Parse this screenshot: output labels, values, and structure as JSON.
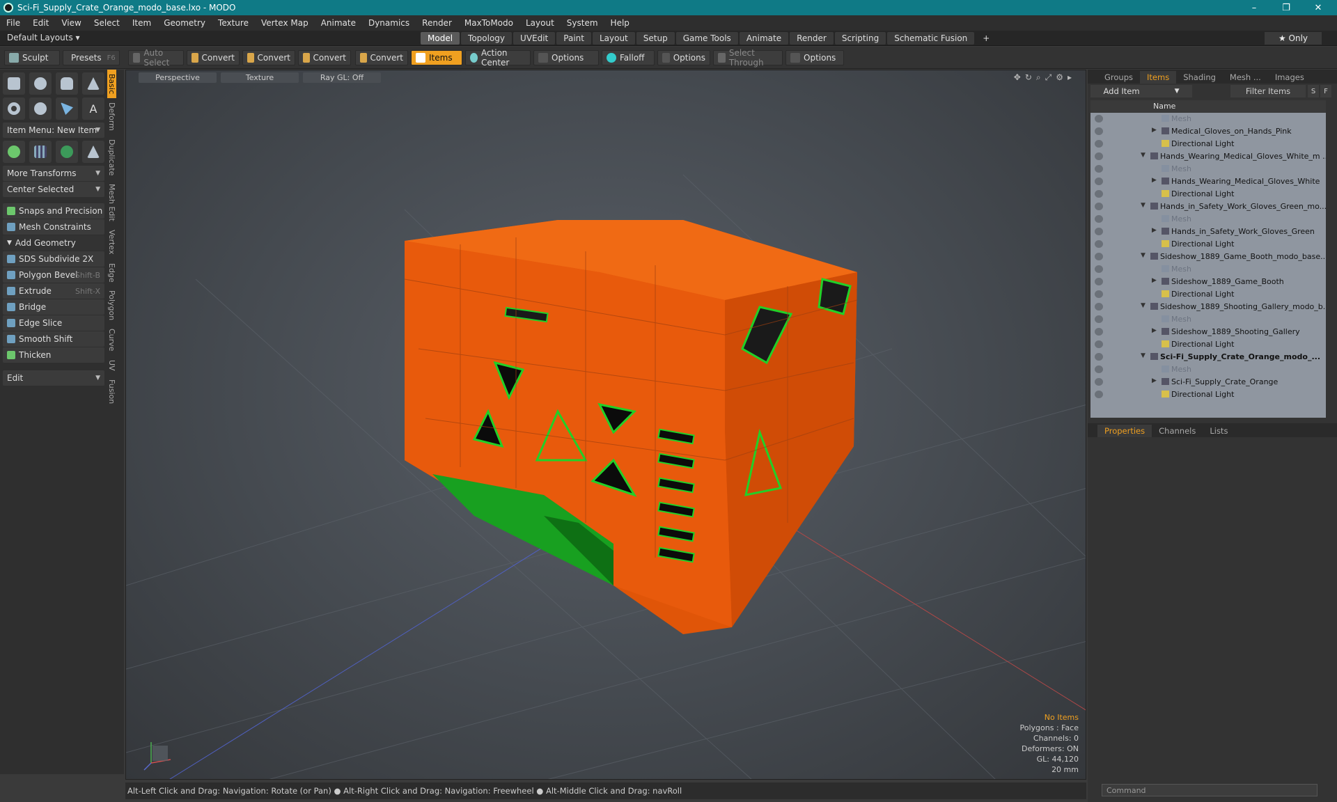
{
  "window": {
    "title": "Sci-Fi_Supply_Crate_Orange_modo_base.lxo - MODO",
    "minimize": "–",
    "maximize": "❐",
    "close": "✕"
  },
  "menu": [
    "File",
    "Edit",
    "View",
    "Select",
    "Item",
    "Geometry",
    "Texture",
    "Vertex Map",
    "Animate",
    "Dynamics",
    "Render",
    "MaxToModo",
    "Layout",
    "System",
    "Help"
  ],
  "layout": {
    "default_layouts": "Default Layouts ▾",
    "tabs": [
      "Model",
      "Topology",
      "UVEdit",
      "Paint",
      "Layout",
      "Setup",
      "Game Tools",
      "Animate",
      "Render",
      "Scripting",
      "Schematic Fusion"
    ],
    "active_tab": "Model",
    "add": "+",
    "only": "★  Only"
  },
  "toolbar": {
    "sculpt": "Sculpt",
    "presets": "Presets",
    "presets_key": "F6",
    "auto_select": "Auto Select",
    "convert": "Convert",
    "items": "Items",
    "action_center": "Action Center",
    "options": "Options",
    "falloff": "Falloff",
    "select_through": "Select Through"
  },
  "left": {
    "item_menu": "Item Menu: New Item",
    "more_transforms": "More Transforms",
    "center_selected": "Center Selected",
    "snaps": "Snaps and Precision",
    "mesh_constraints": "Mesh Constraints",
    "add_geometry": "Add Geometry",
    "tools": [
      {
        "label": "SDS Subdivide 2X",
        "key": ""
      },
      {
        "label": "Polygon Bevel",
        "key": "Shift-B"
      },
      {
        "label": "Extrude",
        "key": "Shift-X"
      },
      {
        "label": "Bridge",
        "key": ""
      },
      {
        "label": "Edge Slice",
        "key": ""
      },
      {
        "label": "Smooth Shift",
        "key": ""
      },
      {
        "label": "Thicken",
        "key": ""
      }
    ],
    "edit": "Edit",
    "vtabs": [
      "Basic",
      "Deform",
      "Duplicate",
      "Mesh Edit",
      "Vertex",
      "Edge",
      "Polygon",
      "Curve",
      "UV",
      "Fusion"
    ]
  },
  "viewport": {
    "perspective": "Perspective",
    "texture": "Texture",
    "raygl": "Ray GL: Off",
    "info": {
      "no_items": "No Items",
      "polygons": "Polygons : Face",
      "channels": "Channels: 0",
      "deformers": "Deformers: ON",
      "gl": "GL: 44,120",
      "scale": "20 mm"
    }
  },
  "status": "Alt-Left Click and Drag: Navigation: Rotate (or Pan) ● Alt-Right Click and Drag: Navigation: Freewheel ● Alt-Middle Click and Drag: navRoll",
  "right": {
    "tabs": [
      "Groups",
      "Items",
      "Shading",
      "Mesh ...",
      "Images"
    ],
    "active_tab": "Items",
    "add_item": "Add Item",
    "filter": "Filter Items",
    "filter_s": "S",
    "filter_f": "F",
    "name_header": "Name",
    "tree": [
      {
        "label": "Mesh",
        "level": 2,
        "kind": "mesh"
      },
      {
        "label": "Medical_Gloves_on_Hands_Pink",
        "level": 2,
        "kind": "item",
        "arrow": "▶"
      },
      {
        "label": "Directional Light",
        "level": 2,
        "kind": "light"
      },
      {
        "label": "Hands_Wearing_Medical_Gloves_White_m ...",
        "level": 1,
        "kind": "group",
        "arrow": "▼"
      },
      {
        "label": "Mesh",
        "level": 2,
        "kind": "mesh"
      },
      {
        "label": "Hands_Wearing_Medical_Gloves_White",
        "level": 2,
        "kind": "item",
        "arrow": "▶"
      },
      {
        "label": "Directional Light",
        "level": 2,
        "kind": "light"
      },
      {
        "label": "Hands_in_Safety_Work_Gloves_Green_mo...",
        "level": 1,
        "kind": "group",
        "arrow": "▼"
      },
      {
        "label": "Mesh",
        "level": 2,
        "kind": "mesh"
      },
      {
        "label": "Hands_in_Safety_Work_Gloves_Green",
        "level": 2,
        "kind": "item",
        "arrow": "▶"
      },
      {
        "label": "Directional Light",
        "level": 2,
        "kind": "light"
      },
      {
        "label": "Sideshow_1889_Game_Booth_modo_base....",
        "level": 1,
        "kind": "group",
        "arrow": "▼"
      },
      {
        "label": "Mesh",
        "level": 2,
        "kind": "mesh"
      },
      {
        "label": "Sideshow_1889_Game_Booth",
        "level": 2,
        "kind": "item",
        "arrow": "▶"
      },
      {
        "label": "Directional Light",
        "level": 2,
        "kind": "light"
      },
      {
        "label": "Sideshow_1889_Shooting_Gallery_modo_b...",
        "level": 1,
        "kind": "group",
        "arrow": "▼"
      },
      {
        "label": "Mesh",
        "level": 2,
        "kind": "mesh"
      },
      {
        "label": "Sideshow_1889_Shooting_Gallery",
        "level": 2,
        "kind": "item",
        "arrow": "▶"
      },
      {
        "label": "Directional Light",
        "level": 2,
        "kind": "light"
      },
      {
        "label": "Sci-Fi_Supply_Crate_Orange_modo_...",
        "level": 1,
        "kind": "group",
        "arrow": "▼",
        "bold": true
      },
      {
        "label": "Mesh",
        "level": 2,
        "kind": "mesh"
      },
      {
        "label": "Sci-Fi_Supply_Crate_Orange",
        "level": 2,
        "kind": "item",
        "arrow": "▶"
      },
      {
        "label": "Directional Light",
        "level": 2,
        "kind": "light"
      }
    ],
    "prop_tabs": [
      "Properties",
      "Channels",
      "Lists"
    ],
    "prop_active": "Properties",
    "command": "Command"
  },
  "colors": {
    "accent": "#f0a020",
    "crate": "#e85a0c",
    "glow": "#22d028",
    "titlebar": "#0f7a86"
  }
}
